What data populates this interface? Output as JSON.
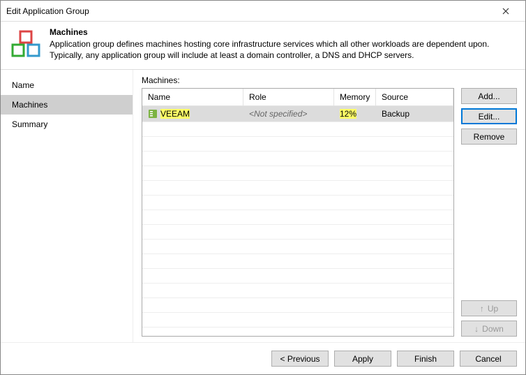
{
  "window": {
    "title": "Edit Application Group"
  },
  "header": {
    "title": "Machines",
    "desc": "Application group defines machines hosting core infrastructure services which all other workloads are dependent upon. Typically, any application group will include at least a domain controller, a DNS and DHCP servers."
  },
  "sidebar": {
    "items": [
      {
        "label": "Name"
      },
      {
        "label": "Machines"
      },
      {
        "label": "Summary"
      }
    ]
  },
  "main": {
    "label": "Machines:",
    "columns": {
      "name": "Name",
      "role": "Role",
      "memory": "Memory",
      "source": "Source"
    },
    "rows": [
      {
        "name": "VEEAM",
        "role": "<Not specified>",
        "memory": "12%",
        "source": "Backup"
      }
    ]
  },
  "buttons": {
    "add": "Add...",
    "edit": "Edit...",
    "remove": "Remove",
    "up": "Up",
    "down": "Down"
  },
  "footer": {
    "previous": "< Previous",
    "apply": "Apply",
    "finish": "Finish",
    "cancel": "Cancel"
  }
}
